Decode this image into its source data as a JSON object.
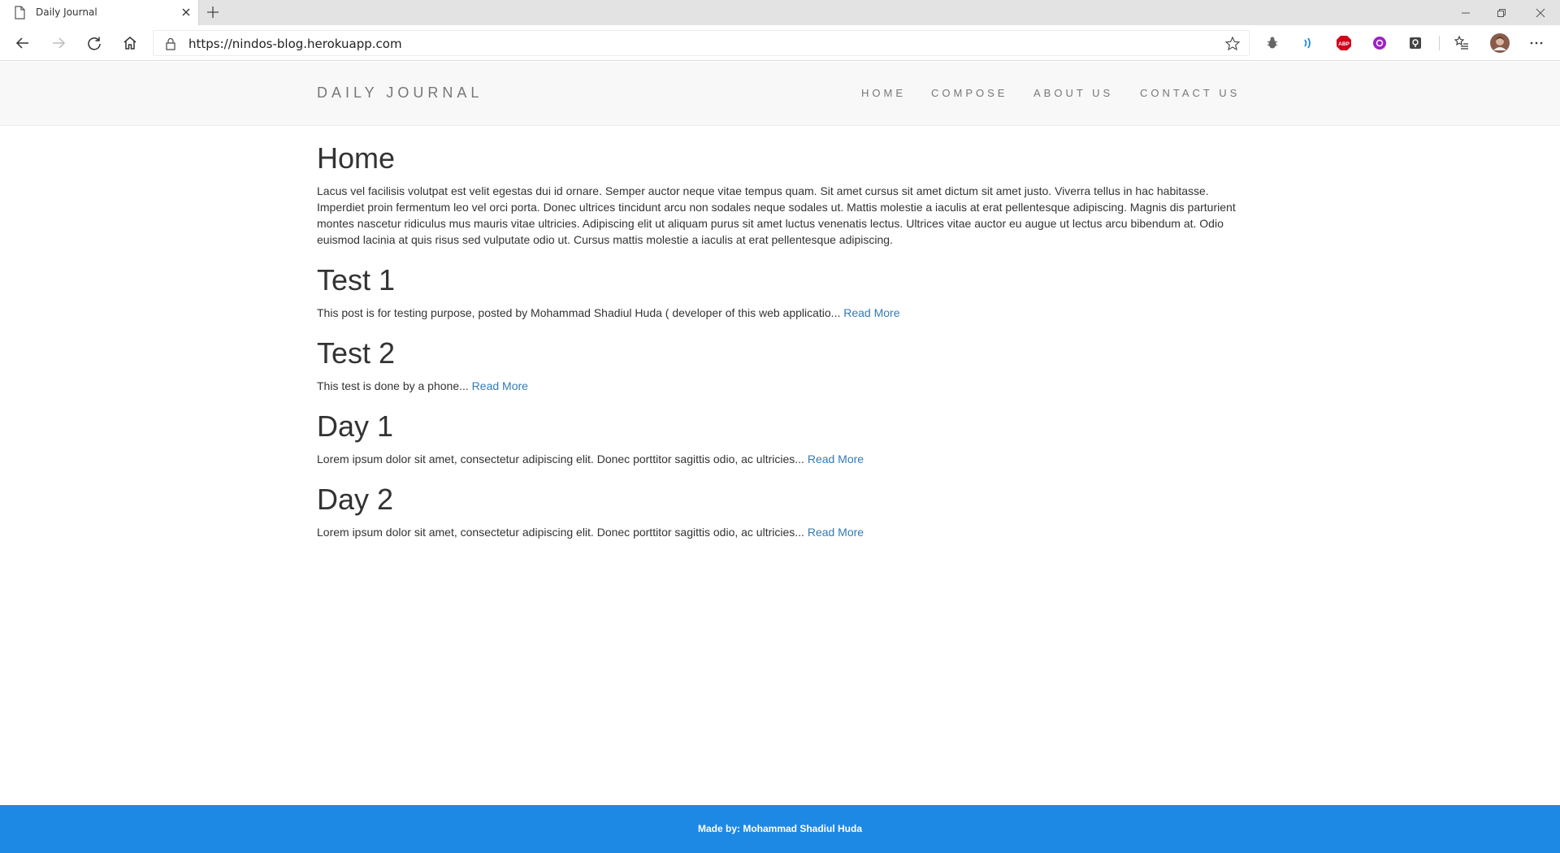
{
  "browser": {
    "tab_title": "Daily Journal",
    "url": "https://nindos-blog.herokuapp.com",
    "extensions": [
      "bug-extension-icon",
      "wave-extension-icon",
      "adblock-plus-icon",
      "purple-extension-icon",
      "shield-extension-icon"
    ],
    "abp_label": "ABP"
  },
  "site": {
    "brand": "DAILY JOURNAL",
    "nav": {
      "home": "HOME",
      "compose": "COMPOSE",
      "about": "ABOUT US",
      "contact": "CONTACT US"
    }
  },
  "home": {
    "title": "Home",
    "body": "Lacus vel facilisis volutpat est velit egestas dui id ornare. Semper auctor neque vitae tempus quam. Sit amet cursus sit amet dictum sit amet justo. Viverra tellus in hac habitasse. Imperdiet proin fermentum leo vel orci porta. Donec ultrices tincidunt arcu non sodales neque sodales ut. Mattis molestie a iaculis at erat pellentesque adipiscing. Magnis dis parturient montes nascetur ridiculus mus mauris vitae ultricies. Adipiscing elit ut aliquam purus sit amet luctus venenatis lectus. Ultrices vitae auctor eu augue ut lectus arcu bibendum at. Odio euismod lacinia at quis risus sed vulputate odio ut. Cursus mattis molestie a iaculis at erat pellentesque adipiscing."
  },
  "posts": [
    {
      "title": "Test 1",
      "excerpt": "This post is for testing purpose, posted by Mohammad Shadiul Huda ( developer of this web applicatio...",
      "read_more": "Read More"
    },
    {
      "title": "Test 2",
      "excerpt": "This test is done by a phone...",
      "read_more": "Read More"
    },
    {
      "title": "Day 1",
      "excerpt": "Lorem ipsum dolor sit amet, consectetur adipiscing elit. Donec porttitor sagittis odio, ac ultricies...",
      "read_more": "Read More"
    },
    {
      "title": "Day 2",
      "excerpt": "Lorem ipsum dolor sit amet, consectetur adipiscing elit. Donec porttitor sagittis odio, ac ultricies...",
      "read_more": "Read More"
    }
  ],
  "footer": {
    "text": "Made by: Mohammad Shadiul Huda"
  },
  "colors": {
    "footer_bg": "#1e88e5",
    "link": "#337ab7",
    "header_bg": "#f8f8f8"
  }
}
